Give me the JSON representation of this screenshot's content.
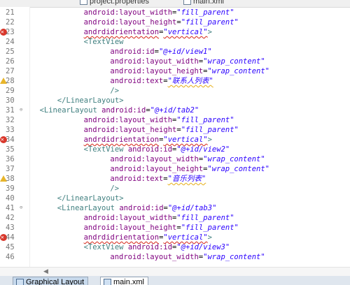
{
  "top_tabs": [
    {
      "label": "project.properties"
    },
    {
      "label": "main.xml"
    }
  ],
  "bottom_tabs": [
    {
      "label": "Graphical Layout"
    },
    {
      "label": "main.xml"
    }
  ],
  "colors": {
    "xml_tag": "#3f7f7f",
    "xml_attribute": "#7f007f",
    "xml_value": "#2a00ff",
    "error_marker": "#d9372b",
    "warning_marker": "#e8b52a"
  },
  "editor": {
    "lines": [
      {
        "num": "21",
        "marker": "",
        "fold": "",
        "indent": 6,
        "parts": [
          {
            "t": "attr",
            "s": "android:layout_width"
          },
          {
            "t": "eq",
            "s": "="
          },
          {
            "t": "val",
            "s": "\"fill_parent\""
          }
        ]
      },
      {
        "num": "22",
        "marker": "",
        "fold": "",
        "indent": 6,
        "parts": [
          {
            "t": "attr",
            "s": "android:layout_height"
          },
          {
            "t": "eq",
            "s": "="
          },
          {
            "t": "val",
            "s": "\"fill_parent\""
          }
        ]
      },
      {
        "num": "23",
        "marker": "error",
        "fold": "",
        "indent": 6,
        "parts": [
          {
            "t": "attr squig",
            "s": "andrdidrientation"
          },
          {
            "t": "eq",
            "s": "="
          },
          {
            "t": "val squig",
            "s": "\"vertical\""
          },
          {
            "t": "tag",
            "s": ">"
          }
        ]
      },
      {
        "num": "24",
        "marker": "",
        "fold": "",
        "indent": 6,
        "parts": [
          {
            "t": "tag",
            "s": "<TextView"
          }
        ]
      },
      {
        "num": "25",
        "marker": "",
        "fold": "",
        "indent": 9,
        "parts": [
          {
            "t": "attr",
            "s": "android:id"
          },
          {
            "t": "eq",
            "s": "="
          },
          {
            "t": "val",
            "s": "\"@+id/view1\""
          }
        ]
      },
      {
        "num": "26",
        "marker": "",
        "fold": "",
        "indent": 9,
        "parts": [
          {
            "t": "attr",
            "s": "android:layout_width"
          },
          {
            "t": "eq",
            "s": "="
          },
          {
            "t": "val",
            "s": "\"wrap_content\""
          }
        ]
      },
      {
        "num": "27",
        "marker": "",
        "fold": "",
        "indent": 9,
        "parts": [
          {
            "t": "attr",
            "s": "android:layout_height"
          },
          {
            "t": "eq",
            "s": "="
          },
          {
            "t": "val",
            "s": "\"wrap_content\""
          }
        ]
      },
      {
        "num": "28",
        "marker": "warning",
        "fold": "",
        "indent": 9,
        "parts": [
          {
            "t": "attr",
            "s": "android:text"
          },
          {
            "t": "eq",
            "s": "="
          },
          {
            "t": "val squigw",
            "s": "\"联系人列表\""
          }
        ]
      },
      {
        "num": "29",
        "marker": "",
        "fold": "",
        "indent": 9,
        "parts": [
          {
            "t": "tag",
            "s": "/>"
          }
        ]
      },
      {
        "num": "30",
        "marker": "",
        "fold": "",
        "indent": 3,
        "parts": [
          {
            "t": "tag",
            "s": "</LinearLayout>"
          }
        ]
      },
      {
        "num": "31",
        "marker": "",
        "fold": "⊖",
        "indent": 1,
        "parts": [
          {
            "t": "tag",
            "s": "<LinearLayout "
          },
          {
            "t": "attr",
            "s": "android:id"
          },
          {
            "t": "eq",
            "s": "="
          },
          {
            "t": "val",
            "s": "\"@+id/tab2\""
          }
        ]
      },
      {
        "num": "32",
        "marker": "",
        "fold": "",
        "indent": 6,
        "parts": [
          {
            "t": "attr",
            "s": "android:layout_width"
          },
          {
            "t": "eq",
            "s": "="
          },
          {
            "t": "val",
            "s": "\"fill_parent\""
          }
        ]
      },
      {
        "num": "33",
        "marker": "",
        "fold": "",
        "indent": 6,
        "parts": [
          {
            "t": "attr",
            "s": "android:layout_height"
          },
          {
            "t": "eq",
            "s": "="
          },
          {
            "t": "val",
            "s": "\"fill_parent\""
          }
        ]
      },
      {
        "num": "34",
        "marker": "error",
        "fold": "",
        "indent": 6,
        "parts": [
          {
            "t": "attr squig",
            "s": "andrdidrientation"
          },
          {
            "t": "eq",
            "s": "="
          },
          {
            "t": "val squig",
            "s": "\"vertical\""
          },
          {
            "t": "tag",
            "s": ">"
          }
        ]
      },
      {
        "num": "35",
        "marker": "",
        "fold": "",
        "indent": 6,
        "parts": [
          {
            "t": "tag",
            "s": "<TextView "
          },
          {
            "t": "attr",
            "s": "android:id"
          },
          {
            "t": "eq",
            "s": "="
          },
          {
            "t": "val",
            "s": "\"@+id/view2\""
          }
        ]
      },
      {
        "num": "36",
        "marker": "",
        "fold": "",
        "indent": 9,
        "parts": [
          {
            "t": "attr",
            "s": "android:layout_width"
          },
          {
            "t": "eq",
            "s": "="
          },
          {
            "t": "val",
            "s": "\"wrap_content\""
          }
        ]
      },
      {
        "num": "37",
        "marker": "",
        "fold": "",
        "indent": 9,
        "parts": [
          {
            "t": "attr",
            "s": "android:layout_height"
          },
          {
            "t": "eq",
            "s": "="
          },
          {
            "t": "val",
            "s": "\"wrap_content\""
          }
        ]
      },
      {
        "num": "38",
        "marker": "warning",
        "fold": "",
        "indent": 9,
        "parts": [
          {
            "t": "attr",
            "s": "android:text"
          },
          {
            "t": "eq",
            "s": "="
          },
          {
            "t": "val squigw",
            "s": "\"音乐列表\""
          }
        ]
      },
      {
        "num": "39",
        "marker": "",
        "fold": "",
        "indent": 9,
        "parts": [
          {
            "t": "tag",
            "s": "/>"
          }
        ]
      },
      {
        "num": "40",
        "marker": "",
        "fold": "",
        "indent": 3,
        "parts": [
          {
            "t": "tag",
            "s": "</LinearLayout>"
          }
        ]
      },
      {
        "num": "41",
        "marker": "",
        "fold": "⊖",
        "indent": 3,
        "parts": [
          {
            "t": "tag",
            "s": "<LinearLayout "
          },
          {
            "t": "attr",
            "s": "android:id"
          },
          {
            "t": "eq",
            "s": "="
          },
          {
            "t": "val",
            "s": "\"@+id/tab3\""
          }
        ]
      },
      {
        "num": "42",
        "marker": "",
        "fold": "",
        "indent": 6,
        "parts": [
          {
            "t": "attr",
            "s": "android:layout_width"
          },
          {
            "t": "eq",
            "s": "="
          },
          {
            "t": "val",
            "s": "\"fill_parent\""
          }
        ]
      },
      {
        "num": "43",
        "marker": "",
        "fold": "",
        "indent": 6,
        "parts": [
          {
            "t": "attr",
            "s": "android:layout_height"
          },
          {
            "t": "eq",
            "s": "="
          },
          {
            "t": "val",
            "s": "\"fill_parent\""
          }
        ]
      },
      {
        "num": "44",
        "marker": "error",
        "fold": "",
        "indent": 6,
        "parts": [
          {
            "t": "attr squig",
            "s": "andrdidrientation"
          },
          {
            "t": "eq",
            "s": "="
          },
          {
            "t": "val squig",
            "s": "\"vertical\""
          },
          {
            "t": "tag",
            "s": ">"
          }
        ]
      },
      {
        "num": "45",
        "marker": "",
        "fold": "",
        "indent": 6,
        "parts": [
          {
            "t": "tag",
            "s": "<TextView "
          },
          {
            "t": "attr",
            "s": "android:id"
          },
          {
            "t": "eq",
            "s": "="
          },
          {
            "t": "val",
            "s": "\"@+id/view3\""
          }
        ]
      },
      {
        "num": "46",
        "marker": "",
        "fold": "",
        "indent": 9,
        "parts": [
          {
            "t": "attr",
            "s": "android:layout_width"
          },
          {
            "t": "eq",
            "s": "="
          },
          {
            "t": "val",
            "s": "\"wrap_content\""
          }
        ]
      }
    ]
  }
}
